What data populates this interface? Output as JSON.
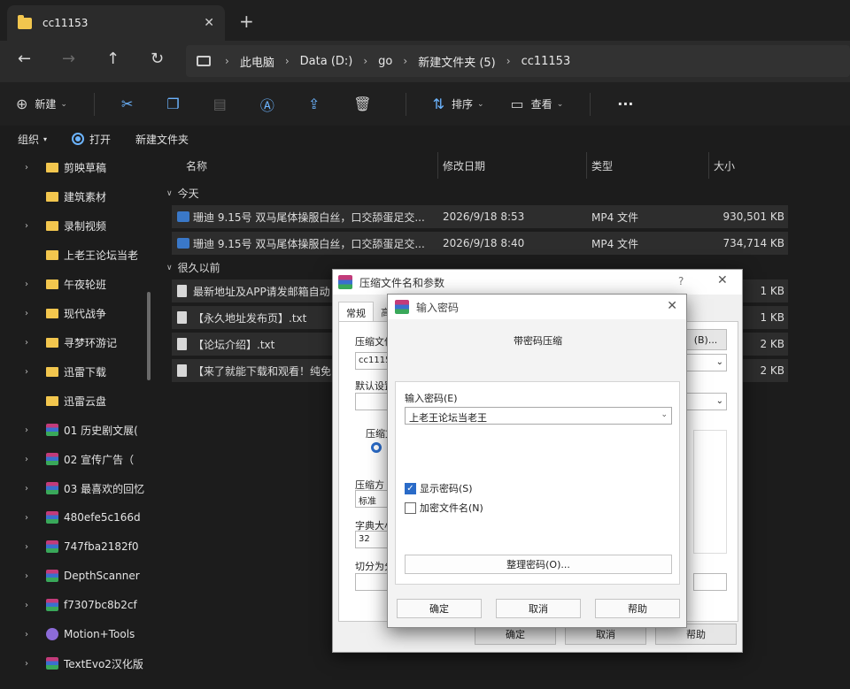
{
  "tab": {
    "title": "cc11153",
    "close": "✕",
    "new_tab": "+"
  },
  "nav": {
    "back": "←",
    "forward": "→",
    "up": "↑",
    "refresh": "↻",
    "breadcrumbs": [
      "此电脑",
      "Data (D:)",
      "go",
      "新建文件夹 (5)",
      "cc11153"
    ],
    "sep": "›"
  },
  "toolbar": {
    "new_label": "新建",
    "sort_label": "排序",
    "view_label": "查看",
    "more": "···"
  },
  "commands": {
    "organize": "组织",
    "open": "打开",
    "new_folder": "新建文件夹"
  },
  "sidebar": {
    "items": [
      {
        "label": "剪映草稿",
        "icon": "folder-icon",
        "arrow": true
      },
      {
        "label": "建筑素材",
        "icon": "folder-icon",
        "arrow": false
      },
      {
        "label": "录制视频",
        "icon": "folder-icon",
        "arrow": true
      },
      {
        "label": "上老王论坛当老",
        "icon": "folder-icon",
        "arrow": false
      },
      {
        "label": "午夜轮班",
        "icon": "folder-icon",
        "arrow": true
      },
      {
        "label": "现代战争",
        "icon": "folder-icon",
        "arrow": true
      },
      {
        "label": "寻梦环游记",
        "icon": "folder-icon",
        "arrow": true
      },
      {
        "label": "迅雷下载",
        "icon": "folder-icon",
        "arrow": true
      },
      {
        "label": "迅雷云盘",
        "icon": "folder-icon",
        "arrow": false
      },
      {
        "label": "01 历史剧文展(",
        "icon": "winrar-icon",
        "arrow": true
      },
      {
        "label": "02 宣传广告（",
        "icon": "winrar-icon",
        "arrow": true
      },
      {
        "label": "03 最喜欢的回忆",
        "icon": "winrar-icon",
        "arrow": true
      },
      {
        "label": "480efe5c166d",
        "icon": "winrar-icon",
        "arrow": true
      },
      {
        "label": "747fba2182f0",
        "icon": "winrar-icon",
        "arrow": true
      },
      {
        "label": "DepthScanner",
        "icon": "winrar-icon",
        "arrow": true
      },
      {
        "label": "f7307bc8b2cf",
        "icon": "winrar-icon",
        "arrow": true
      },
      {
        "label": "Motion+Tools",
        "icon": "motion-icon",
        "arrow": true
      },
      {
        "label": "TextEvo2汉化版",
        "icon": "winrar-icon",
        "arrow": true
      }
    ]
  },
  "filelist": {
    "columns": [
      "名称",
      "修改日期",
      "类型",
      "大小"
    ],
    "groups": [
      "今天",
      "很久以前"
    ],
    "rows": [
      {
        "name": "珊迪 9.15号 双马尾体操服白丝，口交舔蛋足交...",
        "date": "2026/9/18 8:53",
        "type": "MP4 文件",
        "size": "930,501 KB",
        "icon": "video-file-icon"
      },
      {
        "name": "珊迪 9.15号 双马尾体操服白丝，口交舔蛋足交...",
        "date": "2026/9/18 8:40",
        "type": "MP4 文件",
        "size": "734,714 KB",
        "icon": "video-file-icon"
      },
      {
        "name": "最新地址及APP请发邮箱自动",
        "date": "",
        "type": "",
        "size": "1 KB",
        "icon": "text-file-icon"
      },
      {
        "name": "【永久地址发布页】.txt",
        "date": "",
        "type": "",
        "size": "1 KB",
        "icon": "text-file-icon"
      },
      {
        "name": "【论坛介绍】.txt",
        "date": "",
        "type": "",
        "size": "2 KB",
        "icon": "text-file-icon"
      },
      {
        "name": "【来了就能下载和观看！纯免",
        "date": "",
        "type": "",
        "size": "2 KB",
        "icon": "text-file-icon"
      }
    ]
  },
  "back_dialog": {
    "title": "压缩文件名和参数",
    "help": "?",
    "close": "✕",
    "tab_general": "常规",
    "tab_adv": "高",
    "lbl_archive": "压缩文件",
    "archive_value": "cc1115",
    "lbl_default": "默认设置",
    "lbl_format": "压缩文",
    "lbl_method": "压缩方",
    "method_value": "标准",
    "lbl_dict": "字典大小",
    "dict_value": "32",
    "lbl_split": "切分为分",
    "browse": "(B)...",
    "ok": "确定",
    "cancel": "取消",
    "help_btn": "帮助"
  },
  "password_dialog": {
    "title": "输入密码",
    "close": "✕",
    "heading": "带密码压缩",
    "label": "输入密码(E)",
    "value": "上老王论坛当老王",
    "show_password": "显示密码(S)",
    "show_password_checked": true,
    "encrypt_names": "加密文件名(N)",
    "encrypt_names_checked": false,
    "organize": "整理密码(O)...",
    "ok": "确定",
    "cancel": "取消",
    "help": "帮助"
  }
}
